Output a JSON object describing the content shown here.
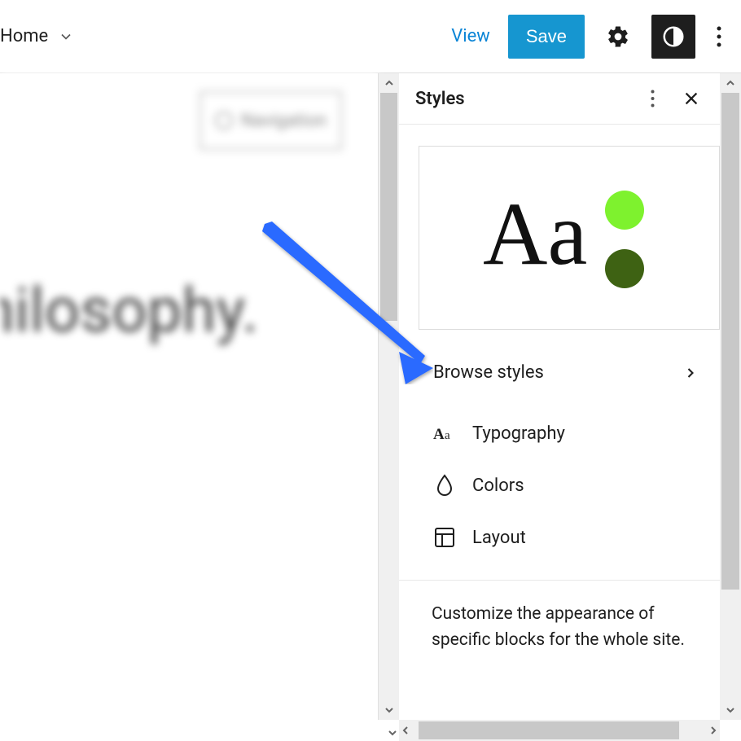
{
  "toolbar": {
    "home_label": "Home",
    "view_label": "View",
    "save_label": "Save"
  },
  "canvas": {
    "navigation_label": "Navigation",
    "heading_text": "hilosophy."
  },
  "sidebar": {
    "title": "Styles",
    "preview": {
      "sample_text": "Aa",
      "swatch_primary": "#7ef22e",
      "swatch_secondary": "#3e6213"
    },
    "browse_label": "Browse styles",
    "options": [
      {
        "label": "Typography"
      },
      {
        "label": "Colors"
      },
      {
        "label": "Layout"
      }
    ],
    "description": "Customize the appearance of specific blocks for the whole site."
  }
}
